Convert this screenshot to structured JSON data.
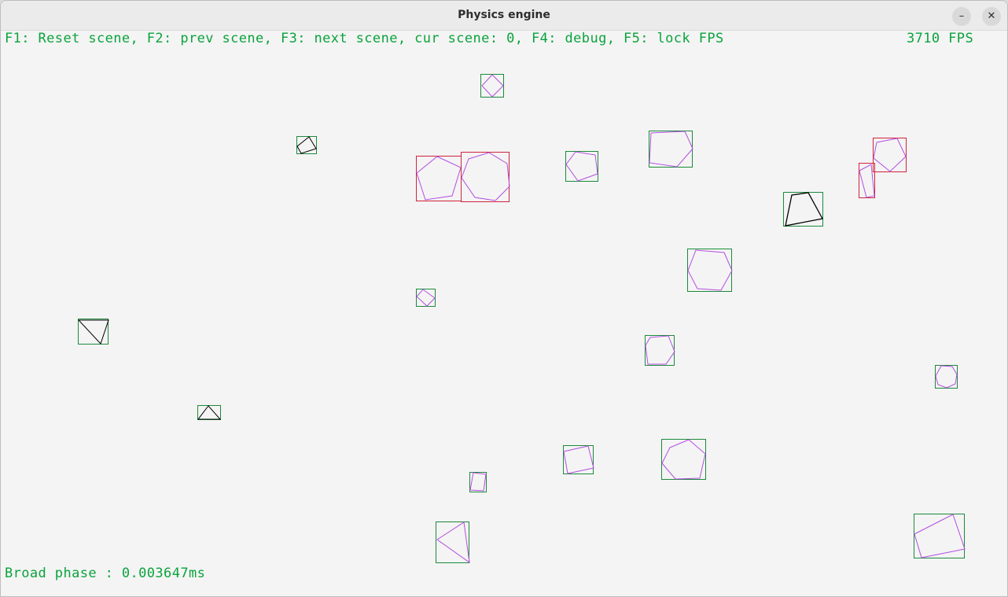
{
  "window": {
    "title": "Physics engine"
  },
  "hud": {
    "help_text": "F1: Reset scene, F2: prev scene, F3: next scene, cur scene: 0, F4: debug, F5: lock FPS",
    "fps_text": "3710 FPS",
    "broad_phase_text": "Broad phase : 0.003647ms"
  },
  "colors": {
    "hud_text": "#0aa33c",
    "aabb_normal": "#1a8a3a",
    "aabb_colliding": "#d0233a",
    "shape_outline": "#b44de0",
    "static_shape": "#000000"
  },
  "icons": {
    "minimize": "minimize-icon",
    "close": "close-icon"
  }
}
